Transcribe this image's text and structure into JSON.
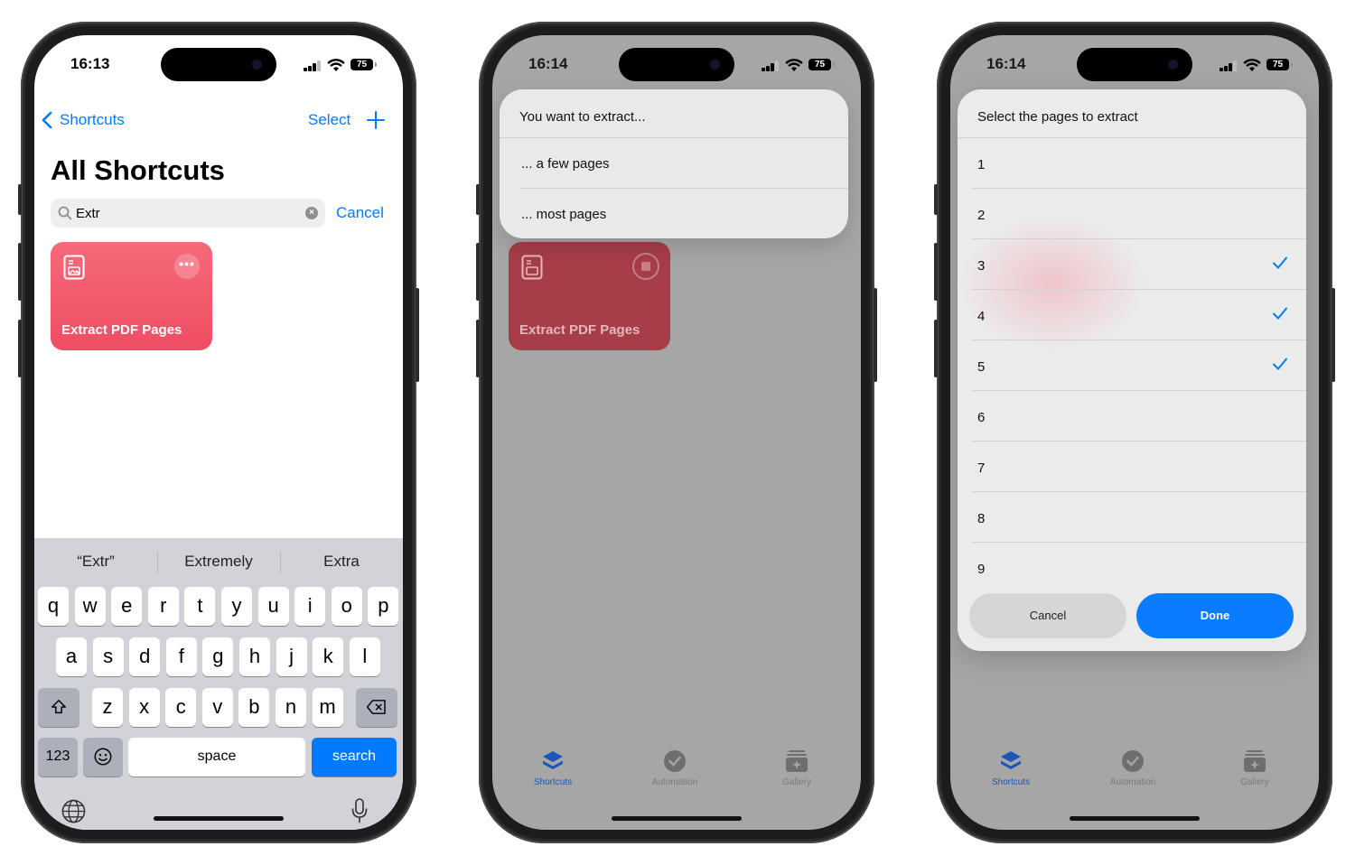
{
  "colors": {
    "accent": "#007aff",
    "tile": "#ef4d63",
    "tile_dim": "#a63d48",
    "done": "#0a7cff"
  },
  "phone1": {
    "time": "16:13",
    "battery": "75",
    "nav": {
      "back_label": "Shortcuts",
      "select_label": "Select"
    },
    "title": "All Shortcuts",
    "search": {
      "value": "Extr",
      "cancel_label": "Cancel"
    },
    "tile": {
      "label": "Extract PDF Pages",
      "icon": "document-image-icon"
    },
    "keyboard": {
      "predictions": [
        "“Extr”",
        "Extremely",
        "Extra"
      ],
      "row1": [
        "q",
        "w",
        "e",
        "r",
        "t",
        "y",
        "u",
        "i",
        "o",
        "p"
      ],
      "row2": [
        "a",
        "s",
        "d",
        "f",
        "g",
        "h",
        "j",
        "k",
        "l"
      ],
      "row3": [
        "z",
        "x",
        "c",
        "v",
        "b",
        "n",
        "m"
      ],
      "numbers_label": "123",
      "space_label": "space",
      "return_label": "search"
    }
  },
  "phone2": {
    "time": "16:14",
    "battery": "75",
    "menu": {
      "title": "You want to extract...",
      "options": [
        "... a few pages",
        "... most pages"
      ]
    },
    "tile_label": "Extract PDF Pages",
    "tabs": [
      "Shortcuts",
      "Automation",
      "Gallery"
    ]
  },
  "phone3": {
    "time": "16:14",
    "battery": "75",
    "sheet": {
      "title": "Select the pages to extract",
      "pages": [
        {
          "label": "1",
          "checked": false
        },
        {
          "label": "2",
          "checked": false
        },
        {
          "label": "3",
          "checked": true
        },
        {
          "label": "4",
          "checked": true
        },
        {
          "label": "5",
          "checked": true
        },
        {
          "label": "6",
          "checked": false
        },
        {
          "label": "7",
          "checked": false
        },
        {
          "label": "8",
          "checked": false
        },
        {
          "label": "9",
          "checked": false
        }
      ],
      "cancel_label": "Cancel",
      "done_label": "Done"
    },
    "tabs": [
      "Shortcuts",
      "Automation",
      "Gallery"
    ]
  }
}
